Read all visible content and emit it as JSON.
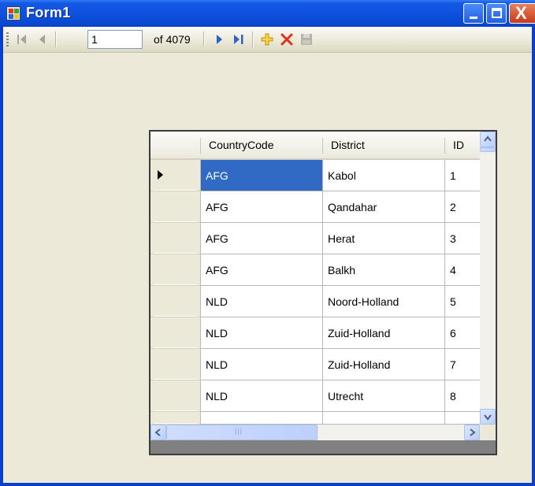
{
  "window": {
    "title": "Form1",
    "close_glyph": "X"
  },
  "navigator": {
    "position_value": "1",
    "count_label": "of 4079",
    "icons": [
      "move-first-icon",
      "move-previous-icon",
      "move-next-icon",
      "move-last-icon",
      "add-new-icon",
      "delete-icon",
      "save-icon"
    ]
  },
  "grid": {
    "columns": [
      "CountryCode",
      "District",
      "ID"
    ],
    "rows": [
      {
        "CountryCode": "AFG",
        "District": "Kabol",
        "ID": "1"
      },
      {
        "CountryCode": "AFG",
        "District": "Qandahar",
        "ID": "2"
      },
      {
        "CountryCode": "AFG",
        "District": "Herat",
        "ID": "3"
      },
      {
        "CountryCode": "AFG",
        "District": "Balkh",
        "ID": "4"
      },
      {
        "CountryCode": "NLD",
        "District": "Noord-Holland",
        "ID": "5"
      },
      {
        "CountryCode": "NLD",
        "District": "Zuid-Holland",
        "ID": "6"
      },
      {
        "CountryCode": "NLD",
        "District": "Zuid-Holland",
        "ID": "7"
      },
      {
        "CountryCode": "NLD",
        "District": "Utrecht",
        "ID": "8"
      }
    ],
    "selected_row": 0,
    "selected_column": "CountryCode"
  },
  "colors": {
    "selection": "#316ac5",
    "titlebar": "#0d50dc",
    "client": "#ece9d8"
  }
}
